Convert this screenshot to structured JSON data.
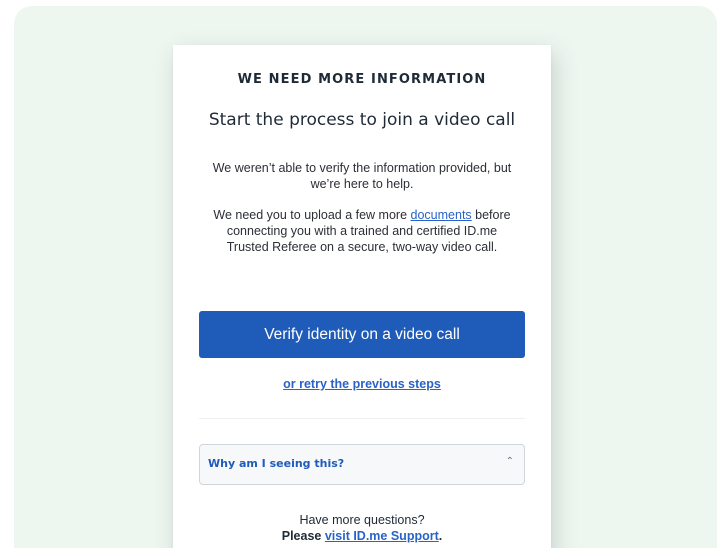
{
  "card": {
    "eyebrow": "WE NEED MORE INFORMATION",
    "headline": "Start the process to join a video call",
    "para1": "We weren’t able to verify the information provided, but we’re here to help.",
    "para2_before": "We need you to upload a few more ",
    "para2_link": "documents",
    "para2_after": " before connecting you with a trained and certified ID.me Trusted Referee on a secure, two-way video call.",
    "primary_button": "Verify identity on a video call",
    "retry_link": "or retry the previous steps",
    "accordion_label": "Why am I seeing this?",
    "questions_line1": "Have more questions?",
    "questions_please": "Please ",
    "questions_link": "visit ID.me Support",
    "questions_period": "."
  },
  "icons": {
    "accordion_chevron": "chevron-up-icon"
  },
  "colors": {
    "background": "#eef6f0",
    "primary": "#1f5bb8",
    "link": "#2a63c7",
    "text": "#1f2a37"
  }
}
